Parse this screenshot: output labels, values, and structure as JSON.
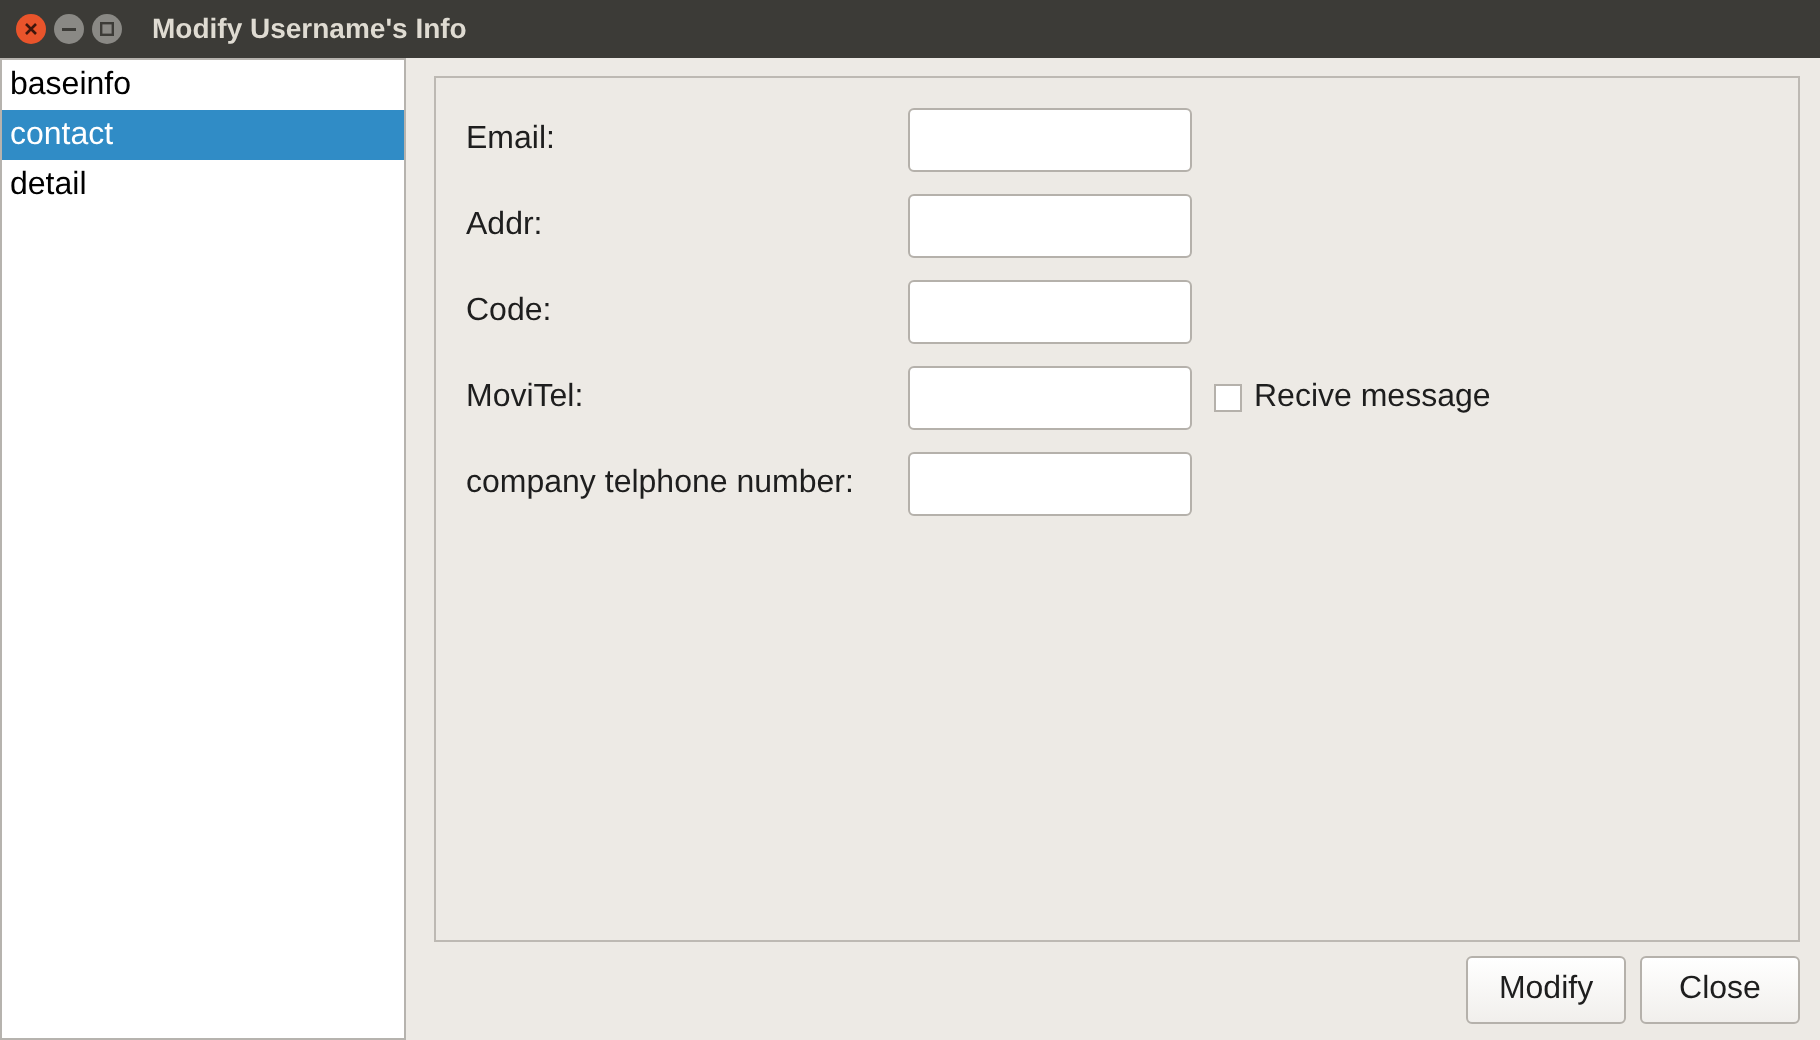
{
  "window": {
    "title": "Modify Username's Info"
  },
  "sidebar": {
    "items": [
      {
        "label": "baseinfo",
        "selected": false
      },
      {
        "label": "contact",
        "selected": true
      },
      {
        "label": "detail",
        "selected": false
      }
    ]
  },
  "form": {
    "rows": [
      {
        "label": "Email:"
      },
      {
        "label": "Addr:"
      },
      {
        "label": "Code:"
      },
      {
        "label": "MoviTel:",
        "checkbox": {
          "label": "Recive message",
          "checked": false
        }
      },
      {
        "label": "company telphone number:"
      }
    ]
  },
  "buttons": [
    "Modify",
    "Close"
  ]
}
